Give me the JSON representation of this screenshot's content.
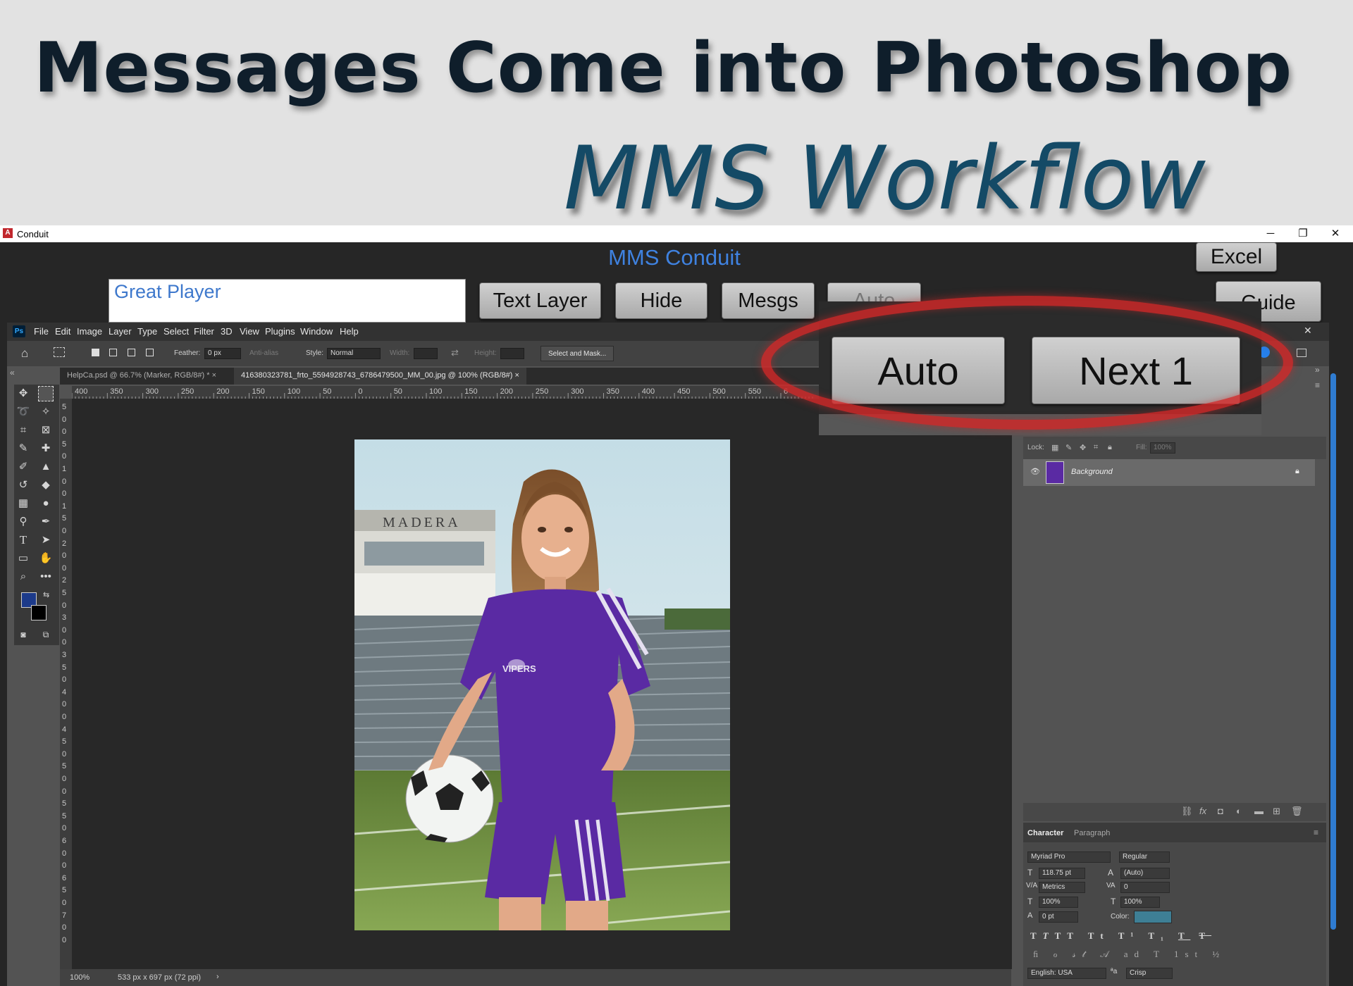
{
  "banner": {
    "title": "Messages Come into Photoshop",
    "subtitle": "MMS Workflow"
  },
  "window": {
    "title": "Conduit",
    "minimize": "─",
    "restore": "❐",
    "close": "✕"
  },
  "conduit": {
    "title": "MMS Conduit",
    "message": "Great Player",
    "buttons": {
      "text_layer": "Text Layer",
      "hide": "Hide",
      "mesgs": "Mesgs",
      "auto_behind": "Auto",
      "excel": "Excel",
      "guide": "Guide",
      "auto": "Auto",
      "next": "Next 1"
    }
  },
  "photoshop": {
    "logo": "Ps",
    "menu": [
      "File",
      "Edit",
      "Image",
      "Layer",
      "Type",
      "Select",
      "Filter",
      "3D",
      "View",
      "Plugins",
      "Window",
      "Help"
    ],
    "options": {
      "feather_label": "Feather:",
      "feather_value": "0 px",
      "antialias": "Anti-alias",
      "style_label": "Style:",
      "style_value": "Normal",
      "width_label": "Width:",
      "height_label": "Height:",
      "select_mask": "Select and Mask..."
    },
    "tabs": [
      "HelpCa.psd @ 66.7% (Marker, RGB/8#) *",
      "416380323781_frto_5594928743_6786479500_MM_00.jpg @ 100% (RGB/8#)"
    ],
    "ruler_ticks": [
      "400",
      "350",
      "300",
      "250",
      "200",
      "150",
      "100",
      "50",
      "0",
      "50",
      "100",
      "150",
      "200",
      "250",
      "300",
      "350",
      "400",
      "450",
      "500",
      "550",
      "6"
    ],
    "ruler_left": [
      "5",
      "0",
      "0",
      "5",
      "0",
      "1",
      "0",
      "0",
      "1",
      "5",
      "0",
      "2",
      "0",
      "0",
      "2",
      "5",
      "0",
      "3",
      "0",
      "0",
      "3",
      "5",
      "0",
      "4",
      "0",
      "0",
      "4",
      "5",
      "0",
      "5",
      "0",
      "0",
      "5",
      "5",
      "0",
      "6",
      "0",
      "0",
      "6",
      "5",
      "0",
      "7",
      "0",
      "0"
    ],
    "status": {
      "zoom": "100%",
      "doc_size": "533 px x 697 px (72 ppi)"
    },
    "layers": {
      "lock_label": "Lock:",
      "fill_label": "Fill:",
      "fill_value": "100%",
      "layer_name": "Background"
    },
    "character": {
      "tab_character": "Character",
      "tab_paragraph": "Paragraph",
      "font_family": "Myriad Pro",
      "font_style": "Regular",
      "size": "118.75 pt",
      "leading": "(Auto)",
      "kerning": "Metrics",
      "tracking": "0",
      "vscale": "100%",
      "hscale": "100%",
      "baseline": "0 pt",
      "color_label": "Color:",
      "color_value": "#3e7f95",
      "language": "English: USA",
      "aa_label": "ªa",
      "aa_value": "Crisp"
    },
    "photo_text": {
      "stadium": "MADERA",
      "jersey": "VIPERS"
    }
  }
}
